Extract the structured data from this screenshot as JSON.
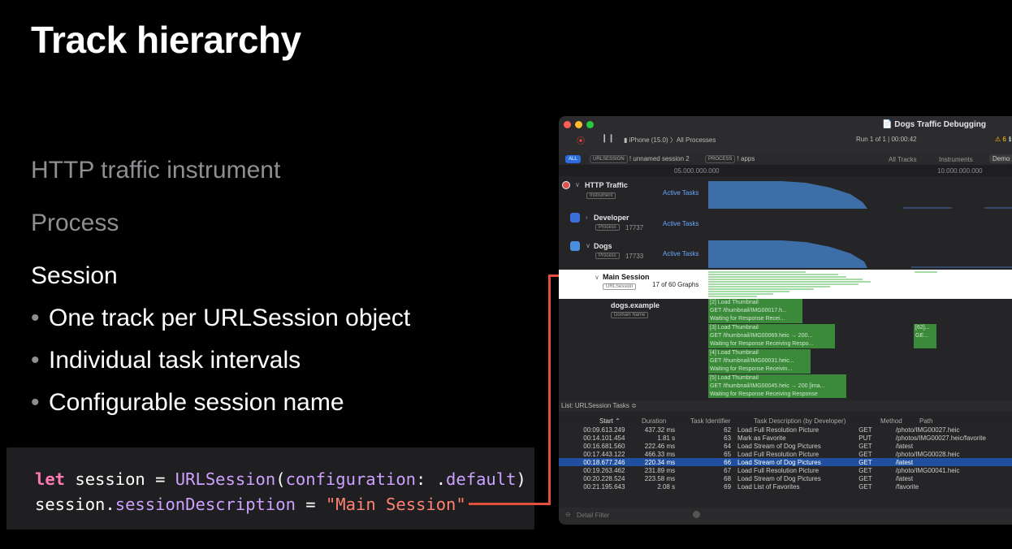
{
  "slide": {
    "title": "Track hierarchy",
    "level1": "HTTP traffic instrument",
    "level2": "Process",
    "level3": "Session",
    "bullets": [
      "One track per URLSession object",
      "Individual task intervals",
      "Configurable session name"
    ],
    "bullet_glyph": "•"
  },
  "code": {
    "line1_kw": "let",
    "line1_a": " session = ",
    "line1_type": "URLSession",
    "line1_b": "(",
    "line1_param": "configuration",
    "line1_c": ": .",
    "line1_default": "default",
    "line1_d": ")",
    "line2_a": "session.",
    "line2_prop": "sessionDescription",
    "line2_b": " = ",
    "line2_str": "\"Main Session\""
  },
  "window": {
    "title": "Dogs Traffic Debugging",
    "device": "iPhone (15.0)",
    "target": "All Processes",
    "run": "Run 1 of 1",
    "time": "00:00:42",
    "warnings": "6",
    "filter_all": "ALL",
    "filter_session_chip": "URLSESSION",
    "filter_session_text": "! unnamed session 2",
    "filter_process_chip": "PROCESS",
    "filter_process_text": "! apps",
    "tabs": [
      "All Tracks",
      "Instruments",
      "Demo"
    ],
    "ruler_a": "05.000.000.000",
    "ruler_b": "10.000.000.000",
    "tracks": {
      "http": {
        "name": "HTTP Traffic",
        "sub": "Instrument",
        "link": "Active Tasks"
      },
      "developer": {
        "name": "Developer",
        "sub": "Process",
        "pid": "17737",
        "link": "Active Tasks"
      },
      "dogs": {
        "name": "Dogs",
        "sub": "Process",
        "pid": "17733",
        "link": "Active Tasks"
      },
      "session": {
        "name": "Main Session",
        "sub": "URLSession",
        "graphs": "17 of 60 Graphs"
      },
      "domain": {
        "name": "dogs.example",
        "sub": "Domain Name"
      }
    },
    "intervals": [
      {
        "l1": "[2] Load Thumbnail",
        "l2": "GET /thumbnail/IMG00017.h...",
        "l3": "Waiting for Response   Recei..."
      },
      {
        "l1": "[3] Load Thumbnail",
        "l2": "GET /thumbnail/IMG00069.heic → 200...",
        "l3": "Waiting for Response   Receiving Respo..."
      },
      {
        "l1": "[4] Load Thumbnail",
        "l2": "GET /thumbnail/IMG00031.heic...",
        "l3": "Waiting for Response   Receivin..."
      },
      {
        "l1": "[5] Load Thumbnail",
        "l2": "GET /thumbnail/IMG00045.heic → 200 [ima...",
        "l3": "Waiting for Response   Receiving Response"
      },
      {
        "l1": "[62]...",
        "l2": "GE...",
        "l3": ""
      }
    ],
    "list_label": "List: URLSession Tasks ≎",
    "columns": [
      "Start",
      "Duration",
      "Task Identifier",
      "Task Description (by Developer)",
      "Method",
      "Path"
    ],
    "rows": [
      [
        "00:09.613.249",
        "437.32 ms",
        "62",
        "Load Full Resolution Picture",
        "GET",
        "/photo/IMG00027.heic"
      ],
      [
        "00:14.101.454",
        "1.81 s",
        "63",
        "Mark as Favorite",
        "PUT",
        "/photos/IMG00027.heic/favorite"
      ],
      [
        "00:16.681.560",
        "222.46 ms",
        "64",
        "Load Stream of Dog Pictures",
        "GET",
        "/latest"
      ],
      [
        "00:17.443.122",
        "466.33 ms",
        "65",
        "Load Full Resolution Picture",
        "GET",
        "/photo/IMG00028.heic"
      ],
      [
        "00:18.677.246",
        "220.34 ms",
        "66",
        "Load Stream of Dog Pictures",
        "GET",
        "/latest"
      ],
      [
        "00:19.263.462",
        "231.89 ms",
        "67",
        "Load Full Resolution Picture",
        "GET",
        "/photo/IMG00041.heic"
      ],
      [
        "00:20.228.524",
        "223.58 ms",
        "68",
        "Load Stream of Dog Pictures",
        "GET",
        "/latest"
      ],
      [
        "00:21.195.643",
        "2.08 s",
        "69",
        "Load List of Favorites",
        "GET",
        "/favorite"
      ]
    ],
    "selected_row": 4,
    "detail_filter_placeholder": "Detail Filter"
  }
}
